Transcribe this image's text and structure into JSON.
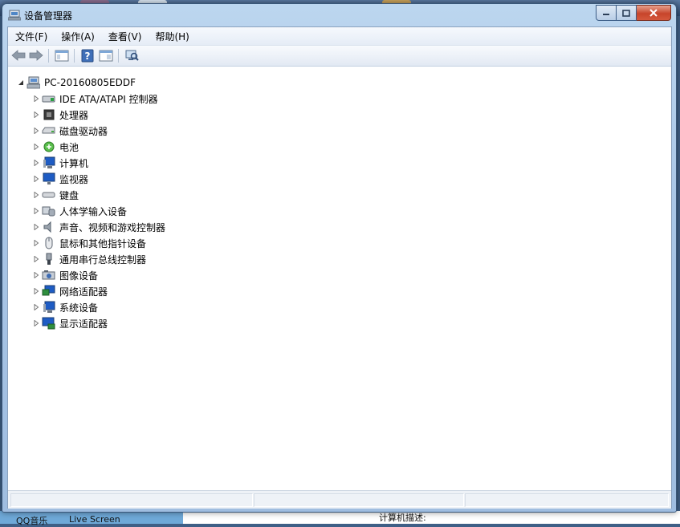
{
  "window": {
    "title": "设备管理器"
  },
  "menu": [
    "文件(F)",
    "操作(A)",
    "查看(V)",
    "帮助(H)"
  ],
  "toolbar": [
    {
      "icon": "back-arrow-icon"
    },
    {
      "icon": "forward-arrow-icon"
    },
    {
      "icon": "show-hide-console-tree-icon"
    },
    {
      "icon": "help-icon"
    },
    {
      "icon": "show-action-pane-icon"
    },
    {
      "icon": "scan-hardware-changes-icon"
    }
  ],
  "tree": {
    "root": {
      "label": "PC-20160805EDDF",
      "icon": "computer-icon",
      "expanded": true
    },
    "children": [
      {
        "label": "IDE ATA/ATAPI 控制器",
        "icon": "ide-controller-icon"
      },
      {
        "label": "处理器",
        "icon": "processor-icon"
      },
      {
        "label": "磁盘驱动器",
        "icon": "disk-drive-icon"
      },
      {
        "label": "电池",
        "icon": "battery-icon"
      },
      {
        "label": "计算机",
        "icon": "computer-icon"
      },
      {
        "label": "监视器",
        "icon": "monitor-icon"
      },
      {
        "label": "键盘",
        "icon": "keyboard-icon"
      },
      {
        "label": "人体学输入设备",
        "icon": "hid-icon"
      },
      {
        "label": "声音、视频和游戏控制器",
        "icon": "speaker-icon"
      },
      {
        "label": "鼠标和其他指针设备",
        "icon": "mouse-icon"
      },
      {
        "label": "通用串行总线控制器",
        "icon": "usb-icon"
      },
      {
        "label": "图像设备",
        "icon": "imaging-device-icon"
      },
      {
        "label": "网络适配器",
        "icon": "network-adapter-icon"
      },
      {
        "label": "系统设备",
        "icon": "system-device-icon"
      },
      {
        "label": "显示适配器",
        "icon": "display-adapter-icon"
      }
    ]
  },
  "desktop": {
    "bottom_texts": [
      "QQ音乐",
      "Live Screen",
      "计算机描述:"
    ]
  }
}
